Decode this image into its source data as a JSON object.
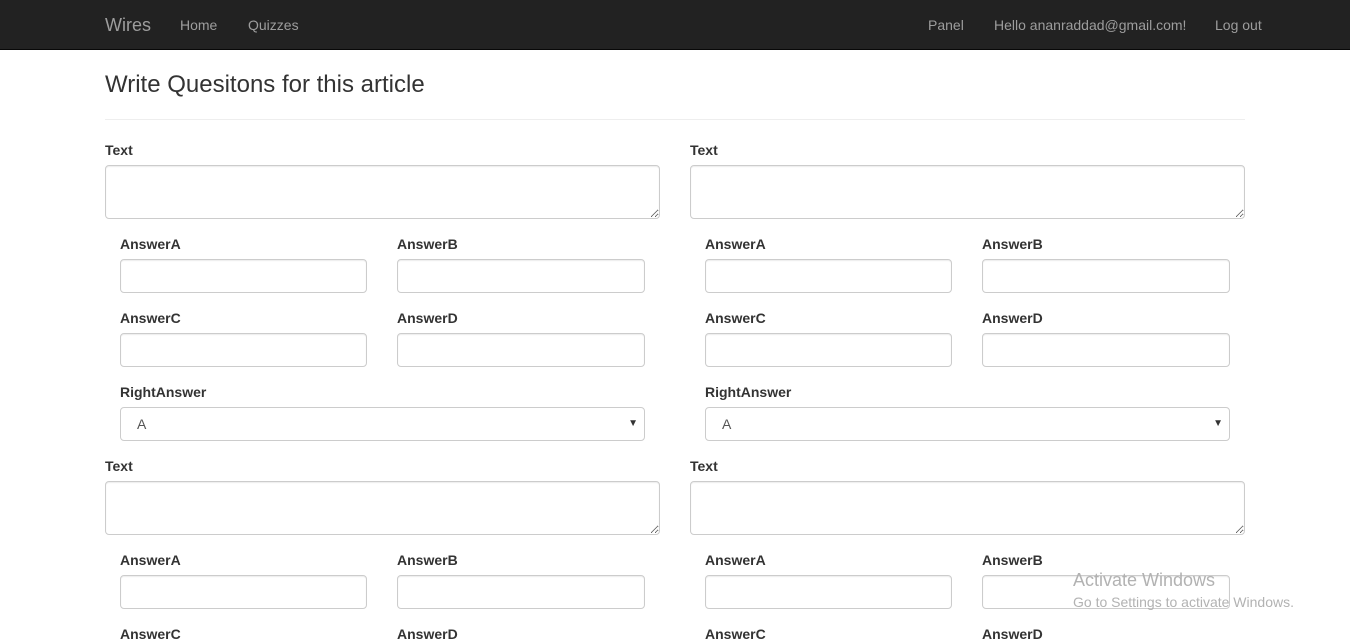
{
  "navbar": {
    "brand": "Wires",
    "home": "Home",
    "quizzes": "Quizzes",
    "panel": "Panel",
    "greeting": "Hello ananraddad@gmail.com!",
    "logout": "Log out"
  },
  "page": {
    "title": "Write Quesitons for this article"
  },
  "form": {
    "text_label": "Text",
    "answer_a_label": "AnswerA",
    "answer_b_label": "AnswerB",
    "answer_c_label": "AnswerC",
    "answer_d_label": "AnswerD",
    "right_answer_label": "RightAnswer",
    "right_answer_value": "A",
    "text_value": "",
    "answer_value": ""
  },
  "watermark": {
    "title": "Activate Windows",
    "subtitle": "Go to Settings to activate Windows."
  },
  "icons": {
    "select_caret": "caret-down-icon"
  },
  "colors": {
    "navbar_bg": "#222222",
    "navbar_text": "#9d9d9d",
    "watermark": "#b2b2b2"
  }
}
